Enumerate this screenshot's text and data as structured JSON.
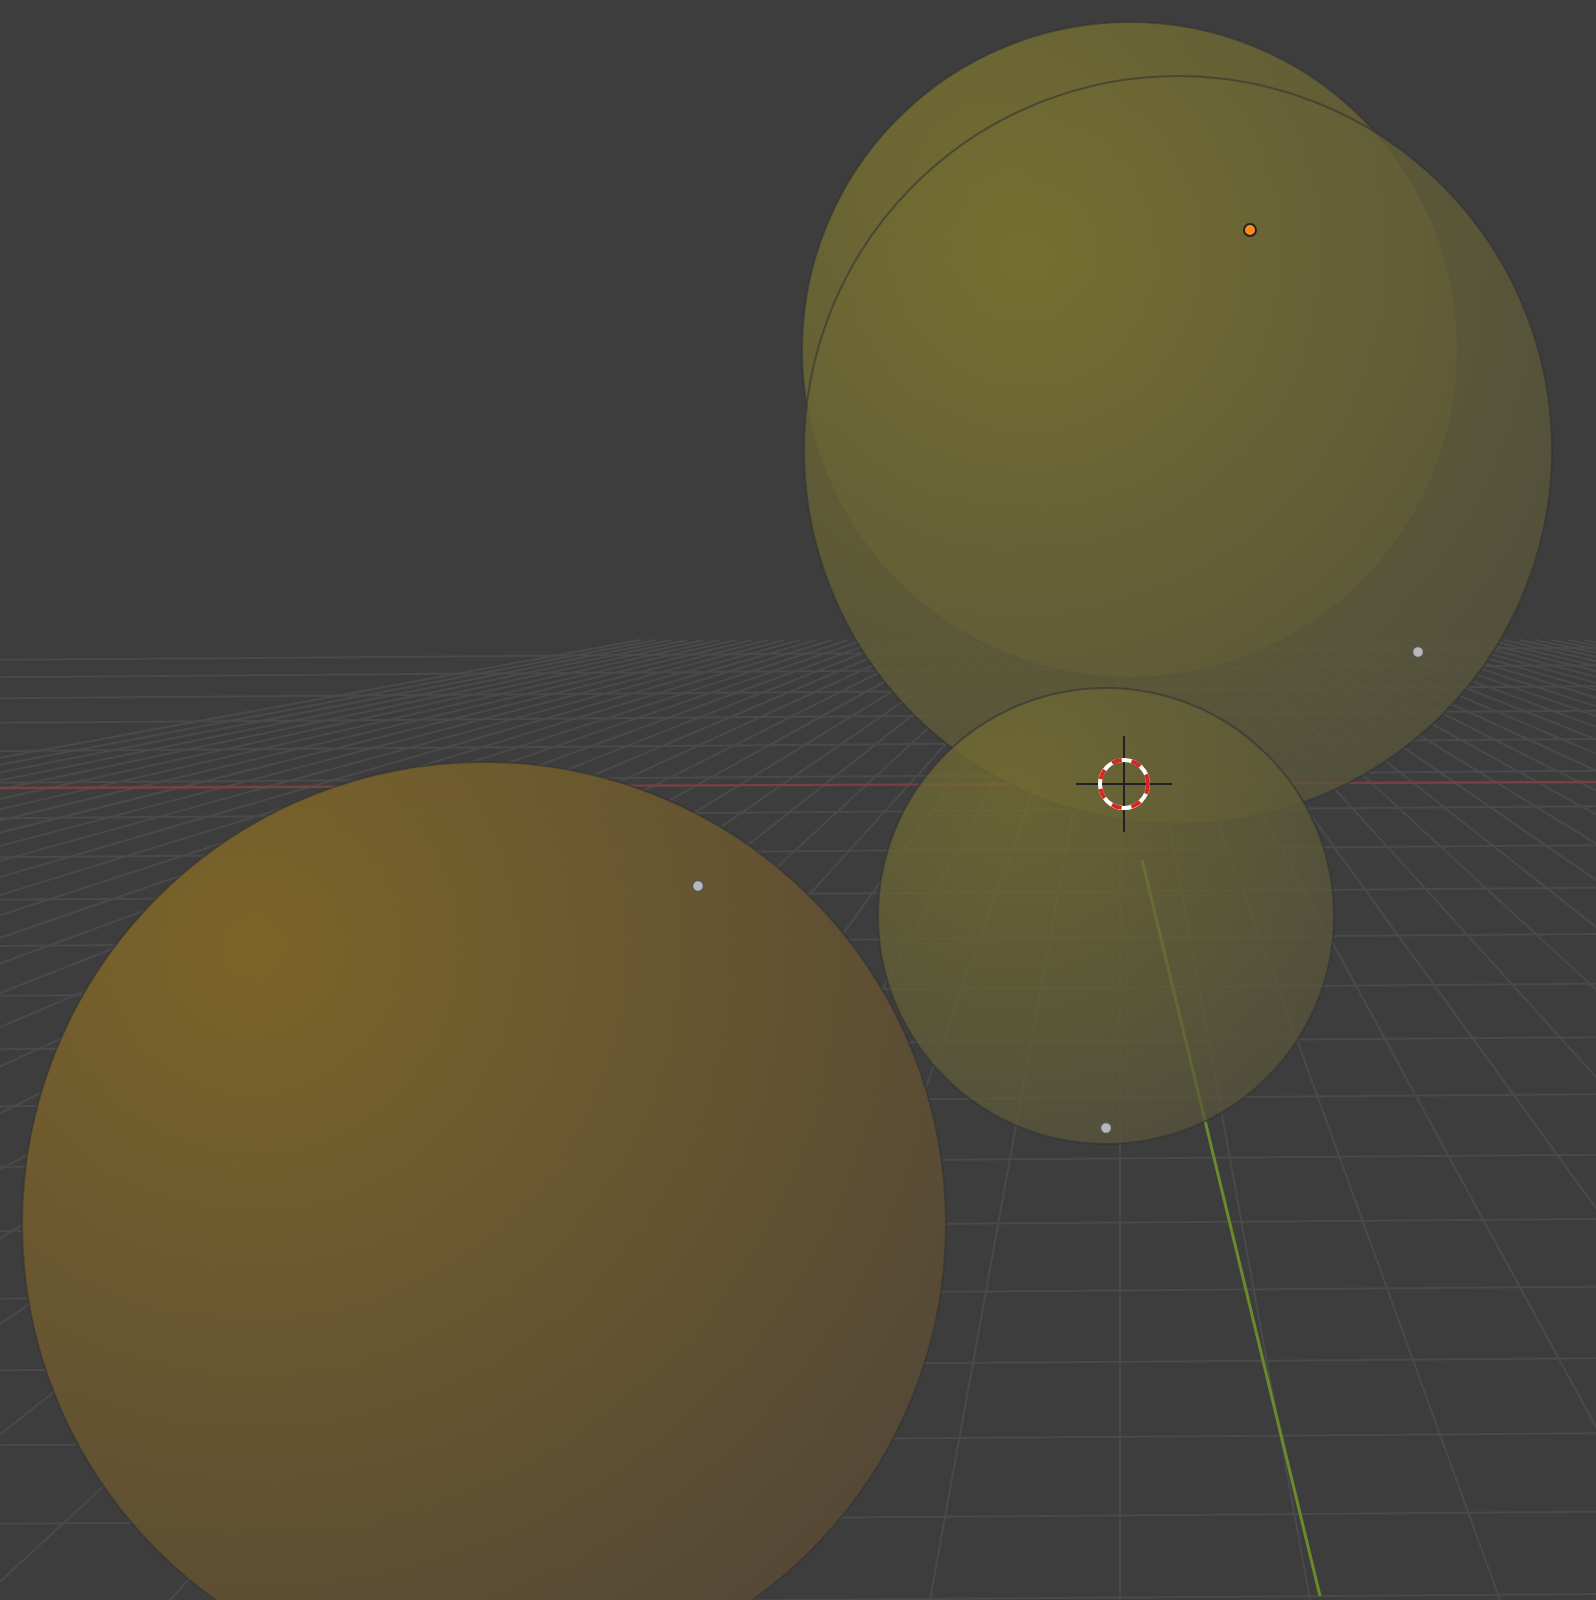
{
  "objects": [
    {
      "selected": true
    },
    {
      "selected": false
    },
    {
      "selected": false
    },
    {
      "selected": false
    }
  ]
}
